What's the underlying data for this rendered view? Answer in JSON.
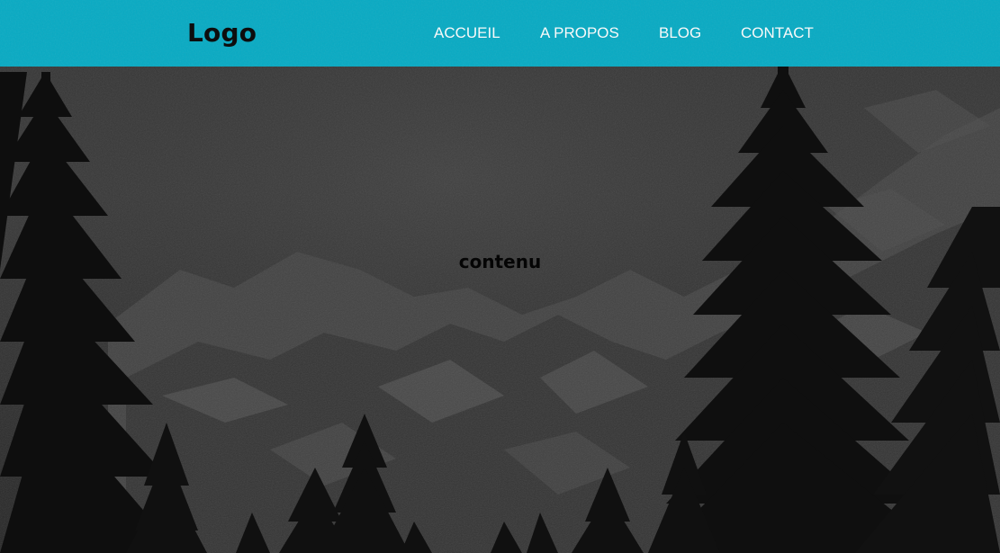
{
  "header": {
    "logo": "Logo",
    "nav": [
      {
        "label": "ACCUEIL"
      },
      {
        "label": "A PROPOS"
      },
      {
        "label": "BLOG"
      },
      {
        "label": "CONTACT"
      }
    ]
  },
  "main": {
    "content": "contenu"
  },
  "colors": {
    "navbar": "#06aec8",
    "nav_text": "#ffffff",
    "logo_text": "#0c0c0c",
    "content_text": "#050505"
  }
}
